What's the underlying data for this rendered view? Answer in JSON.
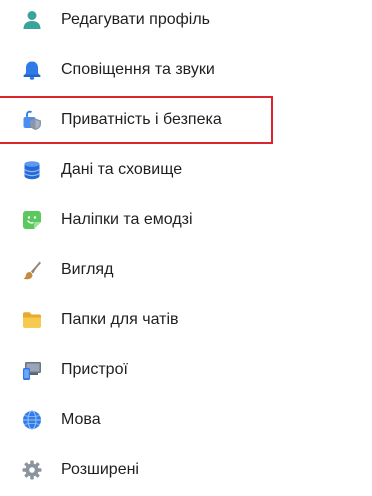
{
  "settings_menu": {
    "items": [
      {
        "label": "Редагувати профіль",
        "icon": "profile-icon"
      },
      {
        "label": "Сповіщення та звуки",
        "icon": "bell-icon"
      },
      {
        "label": "Приватність і безпека",
        "icon": "privacy-lock-icon"
      },
      {
        "label": "Дані та сховище",
        "icon": "database-icon"
      },
      {
        "label": "Наліпки та емодзі",
        "icon": "sticker-icon"
      },
      {
        "label": "Вигляд",
        "icon": "brush-icon"
      },
      {
        "label": "Папки для чатів",
        "icon": "folder-icon"
      },
      {
        "label": "Пристрої",
        "icon": "devices-icon"
      },
      {
        "label": "Мова",
        "icon": "globe-icon"
      },
      {
        "label": "Розширені",
        "icon": "gear-icon"
      }
    ],
    "highlighted_item": "Приватність і безпека"
  },
  "colors": {
    "highlight_border": "#d9262c",
    "text": "#1f1f1f",
    "background": "#ffffff"
  }
}
